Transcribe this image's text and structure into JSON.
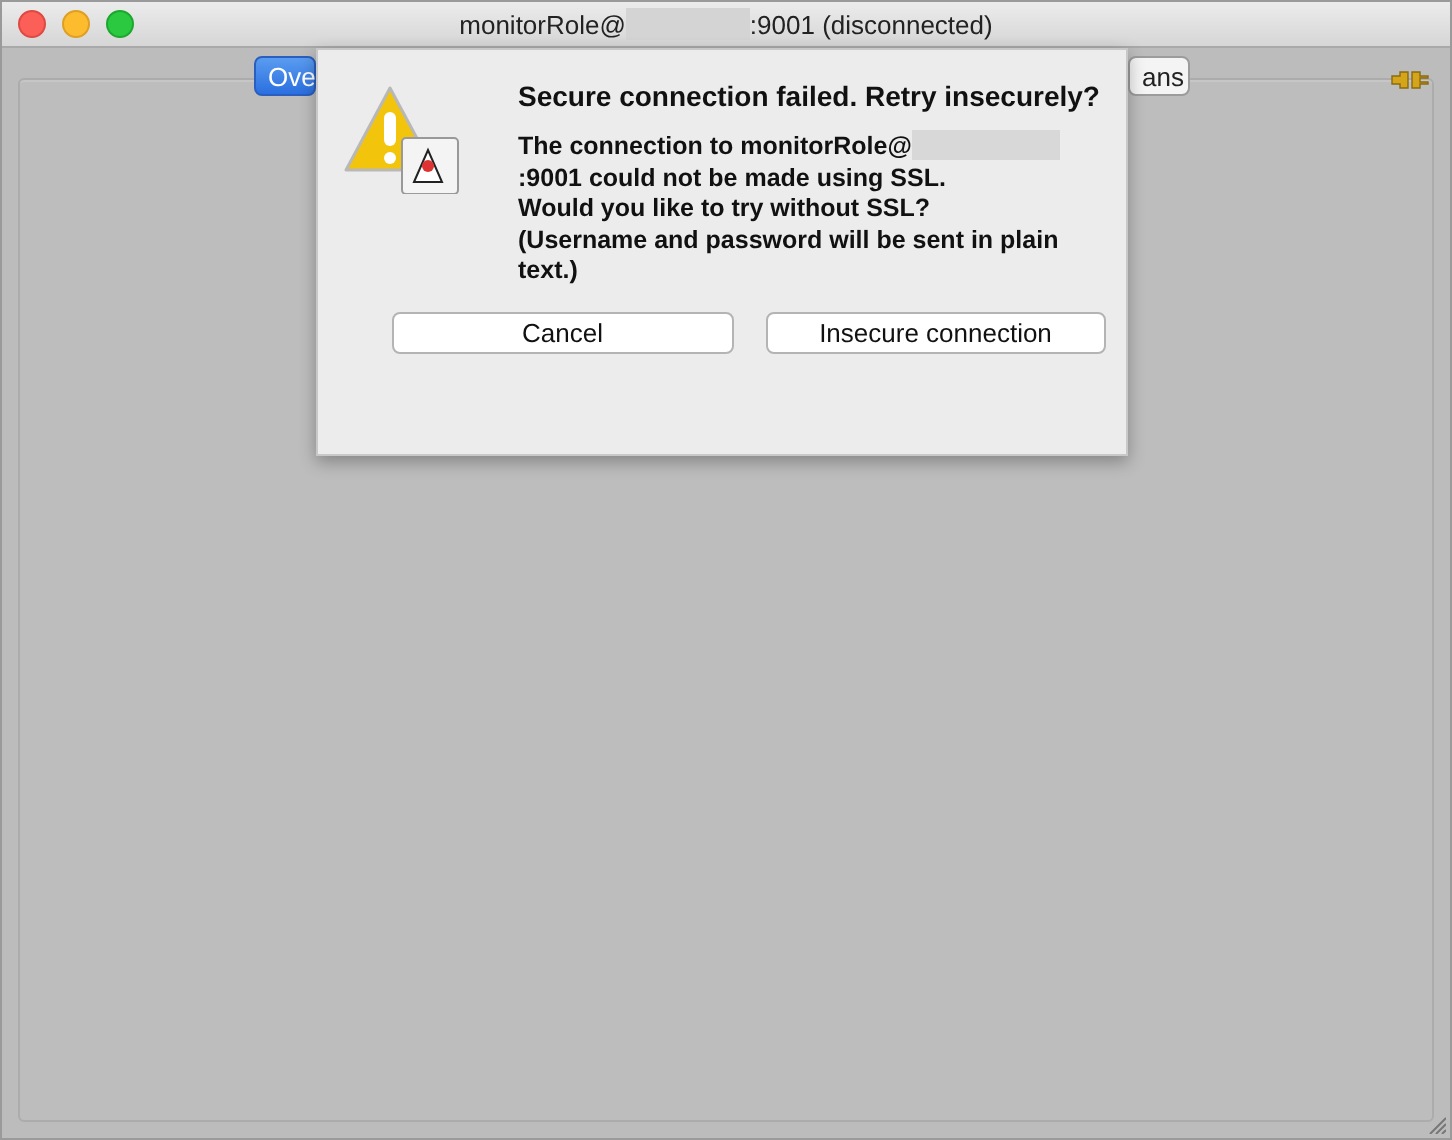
{
  "window": {
    "title_before": "monitorRole@",
    "title_after": ":9001 (disconnected)"
  },
  "tabs": [
    {
      "label": "Ove",
      "selected": true
    },
    {
      "label": "ans",
      "selected": false
    }
  ],
  "dialog": {
    "heading": "Secure connection failed. Retry insecurely?",
    "message_before": "The connection to monitorRole@",
    "message_after": ":9001 could not be made using SSL.",
    "question": "Would you like to try without SSL?",
    "note": "(Username and password will be sent in plain text.)",
    "buttons": [
      "Cancel",
      "Insecure connection"
    ]
  }
}
